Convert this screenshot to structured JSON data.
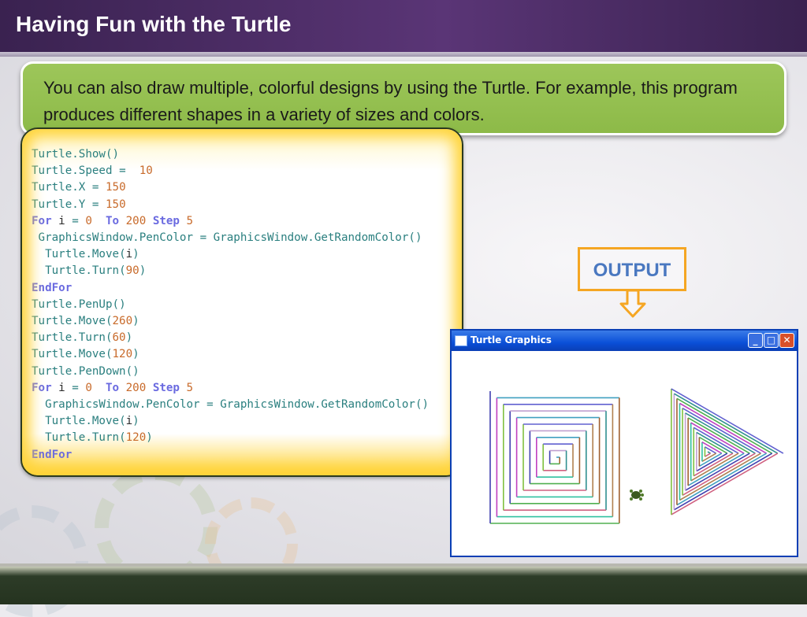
{
  "slide": {
    "title": "Having Fun with the Turtle",
    "intro_text": "You can also draw multiple, colorful designs by using the Turtle.  For example, this program produces different shapes in a variety of sizes and colors."
  },
  "code_lines": [
    "Turtle.Show()",
    "Turtle.Speed =  10",
    "Turtle.X = 150",
    "Turtle.Y = 150",
    "For i = 0  To 200 Step 5",
    " GraphicsWindow.PenColor = GraphicsWindow.GetRandomColor()",
    "  Turtle.Move(i)",
    "  Turtle.Turn(90)",
    "EndFor",
    "Turtle.PenUp()",
    "Turtle.Move(260)",
    "Turtle.Turn(60)",
    "Turtle.Move(120)",
    "Turtle.PenDown()",
    "For i = 0  To 200 Step 5",
    "  GraphicsWindow.PenColor = GraphicsWindow.GetRandomColor()",
    "  Turtle.Move(i)",
    "  Turtle.Turn(120)",
    "EndFor"
  ],
  "output_label": "OUTPUT",
  "window": {
    "title": "Turtle Graphics",
    "minimize_glyph": "_",
    "maximize_glyph": "□",
    "close_glyph": "✕"
  },
  "colors": {
    "accent_green": "#9dc65a",
    "output_border": "#f5a623",
    "output_text": "#4a78c0",
    "header_purple": "#4a2b63"
  }
}
